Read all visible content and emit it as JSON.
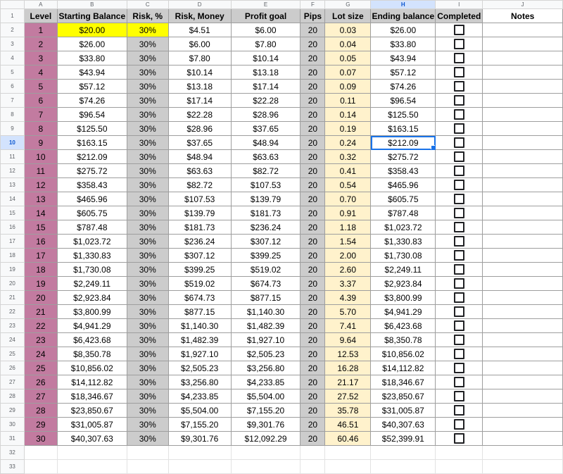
{
  "columns": [
    "A",
    "B",
    "C",
    "D",
    "E",
    "F",
    "G",
    "H",
    "I",
    "J"
  ],
  "selected_column": "H",
  "selected_row": 10,
  "headers": {
    "level": "Level",
    "starting_balance": "Starting Balance",
    "risk_pct": "Risk, %",
    "risk_money": "Risk, Money",
    "profit_goal": "Profit goal",
    "pips": "Pips",
    "lot_size": "Lot size",
    "ending_balance": "Ending balance",
    "completed": "Completed",
    "notes": "Notes"
  },
  "colors": {
    "level_fill": "#c27ba0",
    "grey_fill": "#cccccc",
    "lot_fill": "#fff2cc",
    "highlight_yellow": "#ffff00",
    "selection_blue": "#1a73e8"
  },
  "rows": [
    {
      "level": "1",
      "start": "$20.00",
      "risk_pct": "30%",
      "risk_money": "$4.51",
      "profit": "$6.00",
      "pips": "20",
      "lot": "0.03",
      "end": "$26.00",
      "completed": false
    },
    {
      "level": "2",
      "start": "$26.00",
      "risk_pct": "30%",
      "risk_money": "$6.00",
      "profit": "$7.80",
      "pips": "20",
      "lot": "0.04",
      "end": "$33.80",
      "completed": false
    },
    {
      "level": "3",
      "start": "$33.80",
      "risk_pct": "30%",
      "risk_money": "$7.80",
      "profit": "$10.14",
      "pips": "20",
      "lot": "0.05",
      "end": "$43.94",
      "completed": false
    },
    {
      "level": "4",
      "start": "$43.94",
      "risk_pct": "30%",
      "risk_money": "$10.14",
      "profit": "$13.18",
      "pips": "20",
      "lot": "0.07",
      "end": "$57.12",
      "completed": false
    },
    {
      "level": "5",
      "start": "$57.12",
      "risk_pct": "30%",
      "risk_money": "$13.18",
      "profit": "$17.14",
      "pips": "20",
      "lot": "0.09",
      "end": "$74.26",
      "completed": false
    },
    {
      "level": "6",
      "start": "$74.26",
      "risk_pct": "30%",
      "risk_money": "$17.14",
      "profit": "$22.28",
      "pips": "20",
      "lot": "0.11",
      "end": "$96.54",
      "completed": false
    },
    {
      "level": "7",
      "start": "$96.54",
      "risk_pct": "30%",
      "risk_money": "$22.28",
      "profit": "$28.96",
      "pips": "20",
      "lot": "0.14",
      "end": "$125.50",
      "completed": false
    },
    {
      "level": "8",
      "start": "$125.50",
      "risk_pct": "30%",
      "risk_money": "$28.96",
      "profit": "$37.65",
      "pips": "20",
      "lot": "0.19",
      "end": "$163.15",
      "completed": false
    },
    {
      "level": "9",
      "start": "$163.15",
      "risk_pct": "30%",
      "risk_money": "$37.65",
      "profit": "$48.94",
      "pips": "20",
      "lot": "0.24",
      "end": "$212.09",
      "completed": false
    },
    {
      "level": "10",
      "start": "$212.09",
      "risk_pct": "30%",
      "risk_money": "$48.94",
      "profit": "$63.63",
      "pips": "20",
      "lot": "0.32",
      "end": "$275.72",
      "completed": false
    },
    {
      "level": "11",
      "start": "$275.72",
      "risk_pct": "30%",
      "risk_money": "$63.63",
      "profit": "$82.72",
      "pips": "20",
      "lot": "0.41",
      "end": "$358.43",
      "completed": false
    },
    {
      "level": "12",
      "start": "$358.43",
      "risk_pct": "30%",
      "risk_money": "$82.72",
      "profit": "$107.53",
      "pips": "20",
      "lot": "0.54",
      "end": "$465.96",
      "completed": false
    },
    {
      "level": "13",
      "start": "$465.96",
      "risk_pct": "30%",
      "risk_money": "$107.53",
      "profit": "$139.79",
      "pips": "20",
      "lot": "0.70",
      "end": "$605.75",
      "completed": false
    },
    {
      "level": "14",
      "start": "$605.75",
      "risk_pct": "30%",
      "risk_money": "$139.79",
      "profit": "$181.73",
      "pips": "20",
      "lot": "0.91",
      "end": "$787.48",
      "completed": false
    },
    {
      "level": "15",
      "start": "$787.48",
      "risk_pct": "30%",
      "risk_money": "$181.73",
      "profit": "$236.24",
      "pips": "20",
      "lot": "1.18",
      "end": "$1,023.72",
      "completed": false
    },
    {
      "level": "16",
      "start": "$1,023.72",
      "risk_pct": "30%",
      "risk_money": "$236.24",
      "profit": "$307.12",
      "pips": "20",
      "lot": "1.54",
      "end": "$1,330.83",
      "completed": false
    },
    {
      "level": "17",
      "start": "$1,330.83",
      "risk_pct": "30%",
      "risk_money": "$307.12",
      "profit": "$399.25",
      "pips": "20",
      "lot": "2.00",
      "end": "$1,730.08",
      "completed": false
    },
    {
      "level": "18",
      "start": "$1,730.08",
      "risk_pct": "30%",
      "risk_money": "$399.25",
      "profit": "$519.02",
      "pips": "20",
      "lot": "2.60",
      "end": "$2,249.11",
      "completed": false
    },
    {
      "level": "19",
      "start": "$2,249.11",
      "risk_pct": "30%",
      "risk_money": "$519.02",
      "profit": "$674.73",
      "pips": "20",
      "lot": "3.37",
      "end": "$2,923.84",
      "completed": false
    },
    {
      "level": "20",
      "start": "$2,923.84",
      "risk_pct": "30%",
      "risk_money": "$674.73",
      "profit": "$877.15",
      "pips": "20",
      "lot": "4.39",
      "end": "$3,800.99",
      "completed": false
    },
    {
      "level": "21",
      "start": "$3,800.99",
      "risk_pct": "30%",
      "risk_money": "$877.15",
      "profit": "$1,140.30",
      "pips": "20",
      "lot": "5.70",
      "end": "$4,941.29",
      "completed": false
    },
    {
      "level": "22",
      "start": "$4,941.29",
      "risk_pct": "30%",
      "risk_money": "$1,140.30",
      "profit": "$1,482.39",
      "pips": "20",
      "lot": "7.41",
      "end": "$6,423.68",
      "completed": false
    },
    {
      "level": "23",
      "start": "$6,423.68",
      "risk_pct": "30%",
      "risk_money": "$1,482.39",
      "profit": "$1,927.10",
      "pips": "20",
      "lot": "9.64",
      "end": "$8,350.78",
      "completed": false
    },
    {
      "level": "24",
      "start": "$8,350.78",
      "risk_pct": "30%",
      "risk_money": "$1,927.10",
      "profit": "$2,505.23",
      "pips": "20",
      "lot": "12.53",
      "end": "$10,856.02",
      "completed": false
    },
    {
      "level": "25",
      "start": "$10,856.02",
      "risk_pct": "30%",
      "risk_money": "$2,505.23",
      "profit": "$3,256.80",
      "pips": "20",
      "lot": "16.28",
      "end": "$14,112.82",
      "completed": false
    },
    {
      "level": "26",
      "start": "$14,112.82",
      "risk_pct": "30%",
      "risk_money": "$3,256.80",
      "profit": "$4,233.85",
      "pips": "20",
      "lot": "21.17",
      "end": "$18,346.67",
      "completed": false
    },
    {
      "level": "27",
      "start": "$18,346.67",
      "risk_pct": "30%",
      "risk_money": "$4,233.85",
      "profit": "$5,504.00",
      "pips": "20",
      "lot": "27.52",
      "end": "$23,850.67",
      "completed": false
    },
    {
      "level": "28",
      "start": "$23,850.67",
      "risk_pct": "30%",
      "risk_money": "$5,504.00",
      "profit": "$7,155.20",
      "pips": "20",
      "lot": "35.78",
      "end": "$31,005.87",
      "completed": false
    },
    {
      "level": "29",
      "start": "$31,005.87",
      "risk_pct": "30%",
      "risk_money": "$7,155.20",
      "profit": "$9,301.76",
      "pips": "20",
      "lot": "46.51",
      "end": "$40,307.63",
      "completed": false
    },
    {
      "level": "30",
      "start": "$40,307.63",
      "risk_pct": "30%",
      "risk_money": "$9,301.76",
      "profit": "$12,092.29",
      "pips": "20",
      "lot": "60.46",
      "end": "$52,399.91",
      "completed": false
    }
  ]
}
